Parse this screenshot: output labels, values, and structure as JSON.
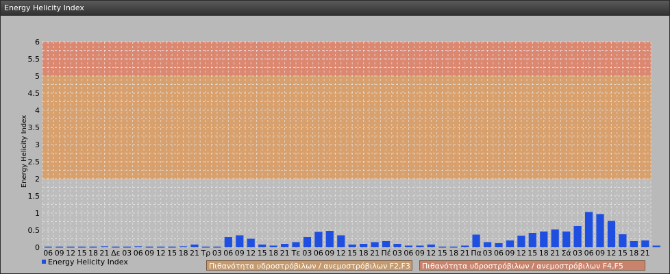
{
  "window": {
    "title": "Energy Helicity Index"
  },
  "bands": [
    {
      "label": "Πιθανότητα υδροστρόβιλων / ανεμοστρόβιλων F2,F3",
      "from": 2,
      "to": 5,
      "color": "#d8a06c"
    },
    {
      "label": "Πιθανότητα υδροστρόβιλων / ανεμοστρόβιλων F4,F5",
      "from": 5,
      "to": 6,
      "color": "#dc8871"
    }
  ],
  "chart_data": {
    "type": "bar",
    "title": "",
    "ylabel": "Energy Helicity Index",
    "xlabel": "",
    "ylim": [
      0,
      6
    ],
    "yticks": [
      "0",
      "0.5",
      "1",
      "1.5",
      "2",
      "2.5",
      "3",
      "3.5",
      "4",
      "4.5",
      "5",
      "5.5",
      "6"
    ],
    "grid": true,
    "legend_position": "bottom-left",
    "bar_color": "#1f4fe0",
    "categories": [
      "06",
      "09",
      "12",
      "15",
      "18",
      "21",
      "Δε",
      "03",
      "06",
      "09",
      "12",
      "15",
      "18",
      "21",
      "Τρ",
      "03",
      "06",
      "09",
      "12",
      "15",
      "18",
      "21",
      "Τε",
      "03",
      "06",
      "09",
      "12",
      "15",
      "18",
      "21",
      "Πέ",
      "03",
      "06",
      "09",
      "12",
      "15",
      "18",
      "21",
      "Πα",
      "03",
      "06",
      "09",
      "12",
      "15",
      "18",
      "21",
      "Σά",
      "03",
      "06",
      "09",
      "12",
      "15",
      "18",
      "21"
    ],
    "series": [
      {
        "name": "Energy Helicity Index",
        "values": [
          0.02,
          0.02,
          0.02,
          0.02,
          0.02,
          0.03,
          0.02,
          0.02,
          0.03,
          0.02,
          0.02,
          0.02,
          0.03,
          0.08,
          0.02,
          0.02,
          0.3,
          0.35,
          0.25,
          0.08,
          0.05,
          0.1,
          0.15,
          0.3,
          0.45,
          0.48,
          0.35,
          0.08,
          0.1,
          0.15,
          0.18,
          0.1,
          0.05,
          0.05,
          0.08,
          0.02,
          0.02,
          0.05,
          0.37,
          0.15,
          0.12,
          0.2,
          0.34,
          0.42,
          0.46,
          0.52,
          0.46,
          0.62,
          1.03,
          0.97,
          0.77,
          0.38,
          0.18,
          0.2,
          0.05
        ]
      }
    ]
  }
}
